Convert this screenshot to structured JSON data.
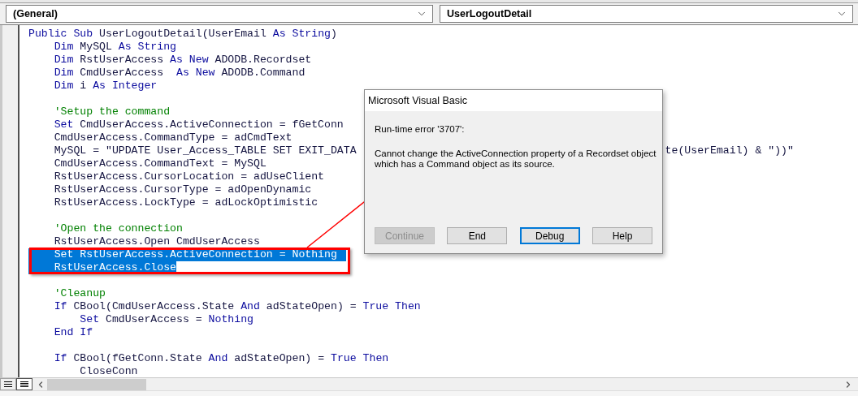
{
  "toolbar": {
    "object_box": {
      "value": "(General)"
    },
    "procedure_box": {
      "value": "UserLogoutDetail"
    }
  },
  "code": {
    "blocks": [
      {
        "lines": [
          {
            "selected": false,
            "segments": [
              {
                "kind": "keyword",
                "text": "Public Sub "
              },
              {
                "kind": "plain",
                "text": "UserLogoutDetail(UserEmail "
              },
              {
                "kind": "keyword",
                "text": "As String"
              },
              {
                "kind": "plain",
                "text": ")"
              }
            ]
          },
          {
            "selected": false,
            "segments": [
              {
                "kind": "keyword",
                "text": "    Dim "
              },
              {
                "kind": "plain",
                "text": "MySQL "
              },
              {
                "kind": "keyword",
                "text": "As String"
              }
            ]
          },
          {
            "selected": false,
            "segments": [
              {
                "kind": "keyword",
                "text": "    Dim "
              },
              {
                "kind": "plain",
                "text": "RstUserAccess "
              },
              {
                "kind": "keyword",
                "text": "As New "
              },
              {
                "kind": "plain",
                "text": "ADODB.Recordset"
              }
            ]
          },
          {
            "selected": false,
            "segments": [
              {
                "kind": "keyword",
                "text": "    Dim "
              },
              {
                "kind": "plain",
                "text": "CmdUserAccess  "
              },
              {
                "kind": "keyword",
                "text": "As New "
              },
              {
                "kind": "plain",
                "text": "ADODB.Command"
              }
            ]
          },
          {
            "selected": false,
            "segments": [
              {
                "kind": "keyword",
                "text": "    Dim "
              },
              {
                "kind": "plain",
                "text": "i "
              },
              {
                "kind": "keyword",
                "text": "As Integer"
              }
            ]
          }
        ]
      },
      {
        "lines": [
          {
            "selected": false,
            "segments": [
              {
                "kind": "comment",
                "text": "    'Setup the command"
              }
            ]
          },
          {
            "selected": false,
            "segments": [
              {
                "kind": "keyword",
                "text": "    Set "
              },
              {
                "kind": "plain",
                "text": "CmdUserAccess.ActiveConnection = fGetConn"
              }
            ]
          },
          {
            "selected": false,
            "segments": [
              {
                "kind": "plain",
                "text": "    CmdUserAccess.CommandType = adCmdText"
              }
            ]
          },
          {
            "selected": false,
            "segments": [
              {
                "kind": "plain",
                "text": "    MySQL = \"UPDATE User_Access_TABLE SET EXIT_DATA"
              }
            ],
            "tail": [
              {
                "kind": "plain",
                "text": "te(UserEmail) & \"))\""
              }
            ]
          },
          {
            "selected": false,
            "segments": [
              {
                "kind": "plain",
                "text": "    CmdUserAccess.CommandText = MySQL"
              }
            ]
          },
          {
            "selected": false,
            "segments": [
              {
                "kind": "plain",
                "text": "    RstUserAccess.CursorLocation = adUseClient"
              }
            ]
          },
          {
            "selected": false,
            "segments": [
              {
                "kind": "plain",
                "text": "    RstUserAccess.CursorType = adOpenDynamic"
              }
            ]
          },
          {
            "selected": false,
            "segments": [
              {
                "kind": "plain",
                "text": "    RstUserAccess.LockType = adLockOptimistic"
              }
            ]
          }
        ]
      },
      {
        "lines": [
          {
            "selected": false,
            "segments": [
              {
                "kind": "comment",
                "text": "    'Open the connection"
              }
            ]
          },
          {
            "selected": false,
            "segments": [
              {
                "kind": "plain",
                "text": "    RstUserAccess.Open CmdUserAccess"
              }
            ]
          },
          {
            "selected": true,
            "text": "    Set RstUserAccess.ActiveConnection = Nothing"
          },
          {
            "selected": true,
            "text": "    RstUserAccess.Close"
          }
        ]
      },
      {
        "lines": [
          {
            "selected": false,
            "segments": [
              {
                "kind": "comment",
                "text": "    'Cleanup"
              }
            ]
          },
          {
            "selected": false,
            "segments": [
              {
                "kind": "keyword",
                "text": "    If "
              },
              {
                "kind": "plain",
                "text": "CBool(CmdUserAccess.State "
              },
              {
                "kind": "keyword",
                "text": "And "
              },
              {
                "kind": "plain",
                "text": "adStateOpen) = "
              },
              {
                "kind": "keyword",
                "text": "True Then"
              }
            ]
          },
          {
            "selected": false,
            "segments": [
              {
                "kind": "keyword",
                "text": "        Set "
              },
              {
                "kind": "plain",
                "text": "CmdUserAccess = "
              },
              {
                "kind": "keyword",
                "text": "Nothing"
              }
            ]
          },
          {
            "selected": false,
            "segments": [
              {
                "kind": "keyword",
                "text": "    End If"
              }
            ]
          }
        ]
      },
      {
        "lines": [
          {
            "selected": false,
            "segments": [
              {
                "kind": "keyword",
                "text": "    If "
              },
              {
                "kind": "plain",
                "text": "CBool(fGetConn.State "
              },
              {
                "kind": "keyword",
                "text": "And "
              },
              {
                "kind": "plain",
                "text": "adStateOpen) = "
              },
              {
                "kind": "keyword",
                "text": "True Then"
              }
            ]
          },
          {
            "selected": false,
            "segments": [
              {
                "kind": "plain",
                "text": "        CloseConn"
              }
            ]
          }
        ]
      }
    ]
  },
  "dialog": {
    "title": "Microsoft Visual Basic",
    "error": "Run-time error '3707':",
    "message": "Cannot change the ActiveConnection property of a Recordset object which has a Command object as its source.",
    "buttons": [
      {
        "label": "Continue",
        "disabled": true,
        "default": false
      },
      {
        "label": "End",
        "disabled": false,
        "default": false
      },
      {
        "label": "Debug",
        "disabled": false,
        "default": true
      },
      {
        "label": "Help",
        "disabled": false,
        "default": false
      }
    ]
  }
}
